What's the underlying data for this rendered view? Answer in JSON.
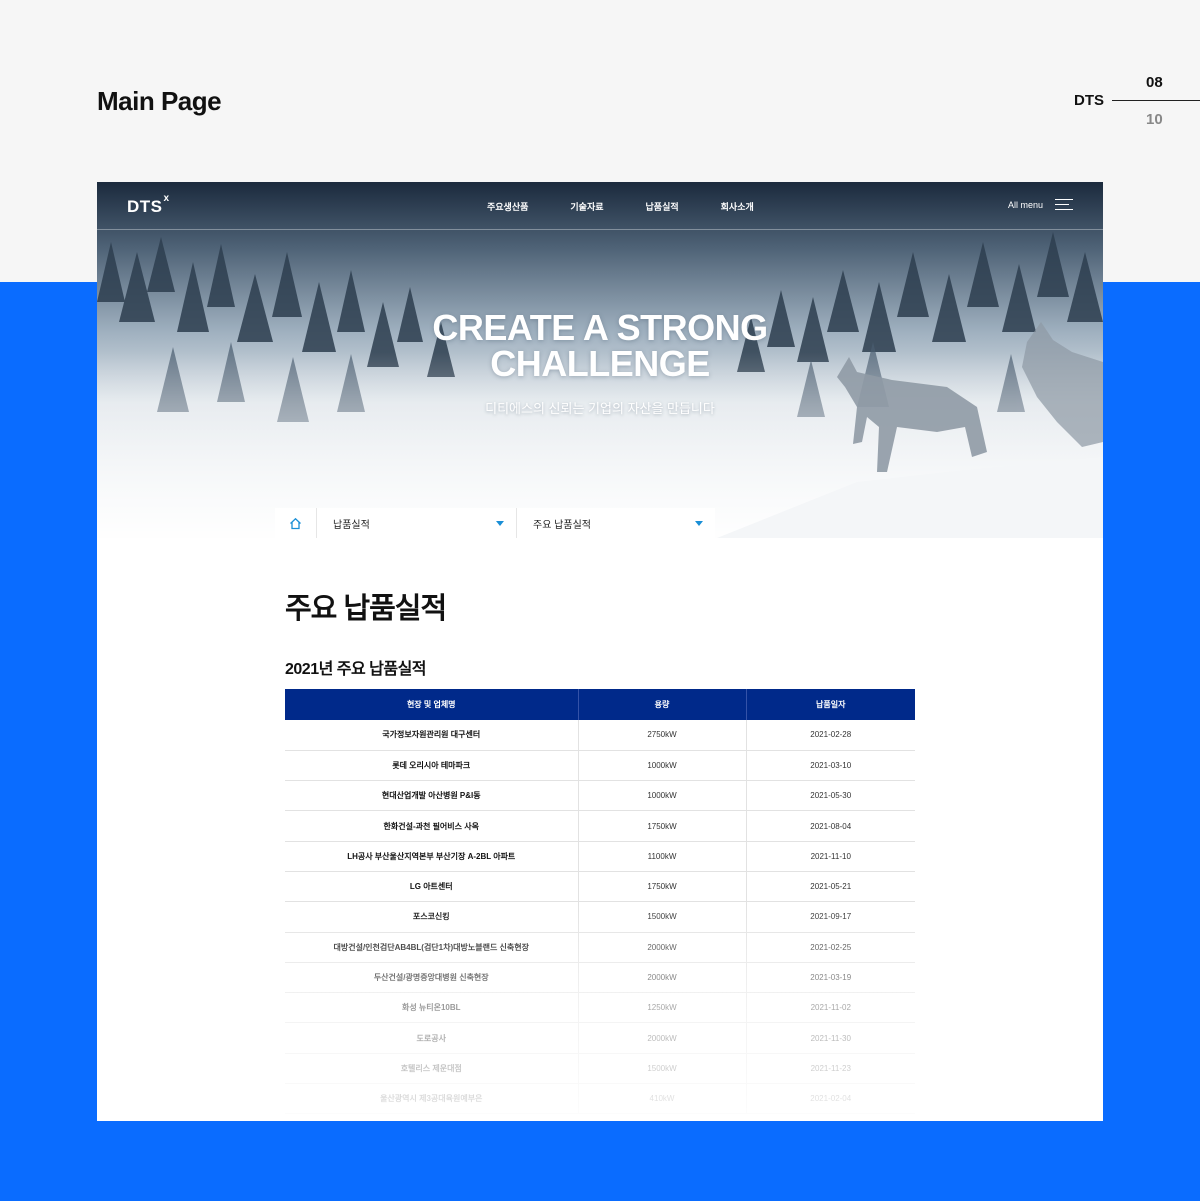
{
  "presentation": {
    "title": "Main Page",
    "brand": "DTS",
    "page_current": "08",
    "page_total": "10"
  },
  "site": {
    "logo": "DTS",
    "logo_mark": "x",
    "nav": [
      "주요생산품",
      "기술자료",
      "납품실적",
      "회사소개"
    ],
    "all_menu": "All menu"
  },
  "hero": {
    "title_line1": "CREATE A STRONG",
    "title_line2": "CHALLENGE",
    "subtitle": "디티에스의 신뢰는 기업의 자산을 만듭니다"
  },
  "breadcrumb": {
    "select1": "납품실적",
    "select2": "주요 납품실적"
  },
  "content": {
    "heading": "주요 납품실적",
    "subheading": "2021년 주요 납품실적"
  },
  "table": {
    "headers": [
      "현장 및 업체명",
      "용량",
      "납품일자"
    ],
    "rows": [
      [
        "국가정보자원관리원 대구센터",
        "2750kW",
        "2021-02-28"
      ],
      [
        "롯데 오리시아 테마파크",
        "1000kW",
        "2021-03-10"
      ],
      [
        "현대산업개발 아산병원 P&I동",
        "1000kW",
        "2021-05-30"
      ],
      [
        "한화건설-과천 필어비스 사옥",
        "1750kW",
        "2021-08-04"
      ],
      [
        "LH공사 부산울산지역본부 부산기장 A-2BL 아파트",
        "1100kW",
        "2021-11-10"
      ],
      [
        "LG 아트센터",
        "1750kW",
        "2021-05-21"
      ],
      [
        "포스코신킹",
        "1500kW",
        "2021-09-17"
      ],
      [
        "대방건설/인천검단AB4BL(검단1차)대방노블랜드 신축현장",
        "2000kW",
        "2021-02-25"
      ],
      [
        "두산건설/광명중앙대병원 신축현장",
        "2000kW",
        "2021-03-19"
      ],
      [
        "화성 뉴티온10BL",
        "1250kW",
        "2021-11-02"
      ],
      [
        "도로공사",
        "2000kW",
        "2021-11-30"
      ],
      [
        "호텔리스 제운대점",
        "1500kW",
        "2021-11-23"
      ],
      [
        "울산광역시 제3공대육원예부은",
        "410kW",
        "2021-02-04"
      ]
    ]
  }
}
